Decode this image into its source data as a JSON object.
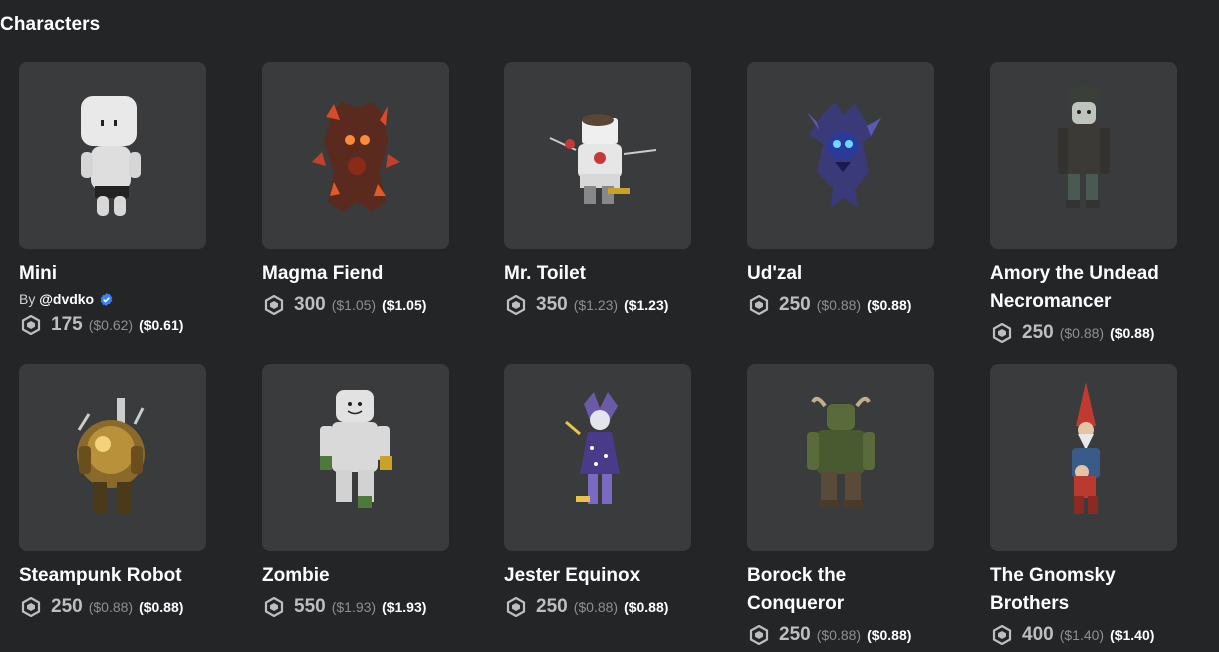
{
  "section": {
    "title": "Characters"
  },
  "items": [
    {
      "name": "Mini",
      "creator_prefix": "By",
      "creator": "@dvdko",
      "price": "175",
      "usd_strike": "($0.62)",
      "usd": "($0.61)"
    },
    {
      "name": "Magma Fiend",
      "price": "300",
      "usd_strike": "($1.05)",
      "usd": "($1.05)"
    },
    {
      "name": "Mr. Toilet",
      "price": "350",
      "usd_strike": "($1.23)",
      "usd": "($1.23)"
    },
    {
      "name": "Ud'zal",
      "price": "250",
      "usd_strike": "($0.88)",
      "usd": "($0.88)"
    },
    {
      "name": "Amory the Undead Necromancer",
      "price": "250",
      "usd_strike": "($0.88)",
      "usd": "($0.88)"
    },
    {
      "name": "Steampunk Robot",
      "price": "250",
      "usd_strike": "($0.88)",
      "usd": "($0.88)"
    },
    {
      "name": "Zombie",
      "price": "550",
      "usd_strike": "($1.93)",
      "usd": "($1.93)"
    },
    {
      "name": "Jester Equinox",
      "price": "250",
      "usd_strike": "($0.88)",
      "usd": "($0.88)"
    },
    {
      "name": "Borock the Conqueror",
      "price": "250",
      "usd_strike": "($0.88)",
      "usd": "($0.88)"
    },
    {
      "name": "The Gnomsky Brothers",
      "price": "400",
      "usd_strike": "($1.40)",
      "usd": "($1.40)"
    }
  ],
  "icons": {
    "currency": "robux-icon",
    "verified": "verified-badge-icon"
  },
  "colors": {
    "background": "#232527",
    "card": "#393b3d",
    "verified": "#3b82f6"
  }
}
